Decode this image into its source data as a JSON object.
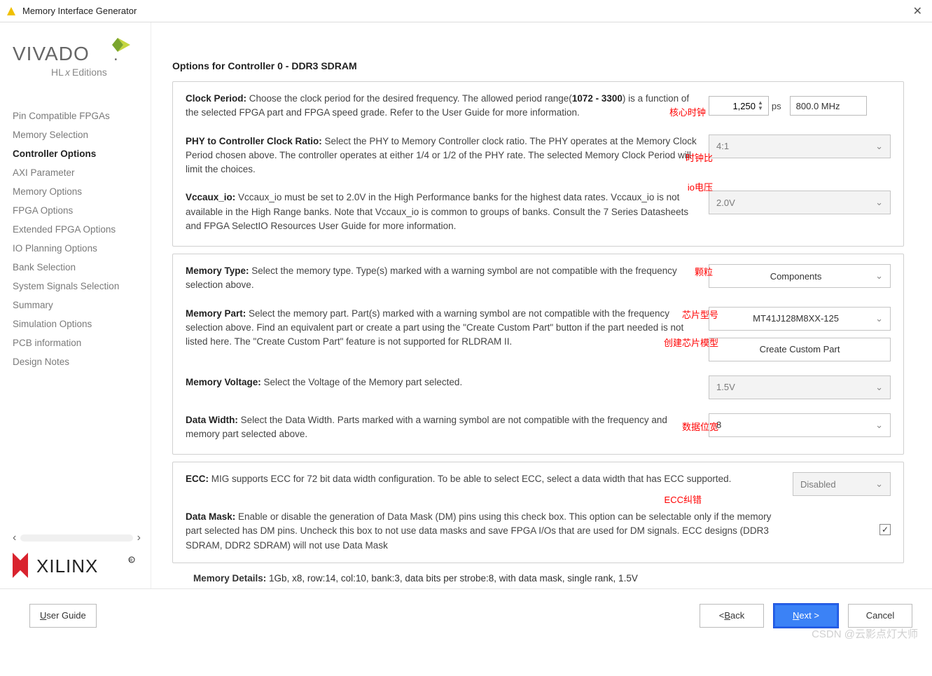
{
  "window": {
    "title": "Memory Interface Generator"
  },
  "nav": {
    "items": [
      "Pin Compatible FPGAs",
      "Memory Selection",
      "Controller Options",
      "AXI Parameter",
      "Memory Options",
      "FPGA Options",
      "Extended FPGA Options",
      "IO Planning Options",
      "Bank Selection",
      "System Signals Selection",
      "Summary",
      "Simulation Options",
      "PCB information",
      "Design Notes"
    ],
    "active_index": 2
  },
  "page": {
    "title": "Options for Controller 0 - DDR3 SDRAM"
  },
  "clock": {
    "label": "Clock Period:",
    "desc_pre": " Choose the clock period for the desired frequency. The allowed period range(",
    "range": "1072 - 3300",
    "desc_post": ") is a function of the selected FPGA part and FPGA speed grade. Refer to the User Guide for more information.",
    "value": "1,250",
    "unit": "ps",
    "freq": "800.0 MHz",
    "anno": "核心时钟"
  },
  "ratio": {
    "label": "PHY to Controller Clock Ratio:",
    "desc": " Select the PHY to Memory Controller clock ratio. The PHY operates at the Memory Clock Period chosen above. The controller operates at either 1/4 or 1/2 of the PHY rate. The selected Memory Clock Period will limit the choices.",
    "value": "4:1",
    "anno": "时钟比"
  },
  "vccaux": {
    "label": "Vccaux_io:",
    "desc": " Vccaux_io must be set to 2.0V in the High Performance banks for the highest data rates. Vccaux_io is not available in the High Range banks. Note that Vccaux_io is common to groups of banks. Consult the 7 Series Datasheets and FPGA SelectIO Resources User Guide for more information.",
    "value": "2.0V",
    "anno": "io电压"
  },
  "memtype": {
    "label": "Memory Type:",
    "desc": " Select the memory type. Type(s) marked with a warning symbol are not compatible with the frequency selection above.",
    "value": "Components",
    "anno": "颗粒"
  },
  "mempart": {
    "label": "Memory Part:",
    "desc": " Select the memory part. Part(s) marked with a warning symbol are not compatible with the frequency selection above. Find an equivalent part or create a part using the \"Create Custom Part\" button if the part needed is not listed here. The \"Create Custom Part\" feature is not supported for RLDRAM II.",
    "value": "MT41J128M8XX-125",
    "button": "Create Custom Part",
    "anno_part": "芯片型号",
    "anno_btn": "创建芯片模型"
  },
  "memvolt": {
    "label": "Memory Voltage:",
    "desc": " Select the Voltage of the Memory part selected.",
    "value": "1.5V"
  },
  "datawidth": {
    "label": "Data Width:",
    "desc": " Select the Data Width. Parts marked with a warning symbol are not compatible with the frequency and memory part selected above.",
    "value": "8",
    "anno": "数据位宽"
  },
  "ecc": {
    "label": "ECC:",
    "desc": " MIG supports ECC for 72 bit data width configuration. To be able to select ECC, select a data width that has ECC supported.",
    "value": "Disabled",
    "anno": "ECC纠错"
  },
  "datamask": {
    "label": "Data Mask:",
    "desc": " Enable or disable the generation of Data Mask (DM) pins using this check box. This option can be selectable only if the memory part selected has DM pins. Uncheck this box to not use data masks and save FPGA I/Os that are used for DM signals. ECC designs (DDR3 SDRAM, DDR2 SDRAM) will not use Data Mask",
    "checked": true
  },
  "memdetails": {
    "label": "Memory Details:",
    "text": " 1Gb, x8, row:14, col:10, bank:3, data bits per strobe:8, with data mask, single rank, 1.5V"
  },
  "footer": {
    "userguide_pre": "",
    "userguide_u": "U",
    "userguide_post": "ser Guide",
    "back_pre": "< ",
    "back_u": "B",
    "back_post": "ack",
    "next_pre": "",
    "next_u": "N",
    "next_post": "ext >",
    "cancel": "Cancel"
  },
  "watermark": "CSDN @云影点灯大师"
}
